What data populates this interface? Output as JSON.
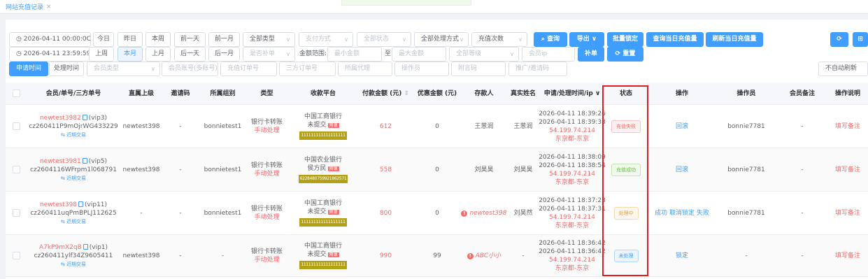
{
  "tab": {
    "title": "网站充值记录",
    "close": "×"
  },
  "filters": {
    "start_time": "2026-04-11 00:00:0C",
    "end_time": "2026-04-11 23:59:59",
    "today": "今日",
    "yesterday": "昨日",
    "this_week": "本周",
    "prev_day": "前一天",
    "prev_month": "前一月",
    "last_week": "上周",
    "this_month": "本月",
    "last_month": "上月",
    "next_day": "后一天",
    "next_month": "后一月",
    "all_types": "全部类型",
    "pay_method": "支付方式",
    "all_status": "全部状态",
    "all_process": "全部处理方式",
    "recharge_count": "充值次数",
    "is_supplement": "是否补单",
    "amount_range": "金额范围:",
    "min_amount": "最小金额",
    "to": "至",
    "max_amount": "最大金额",
    "all_levels": "全部等级",
    "member_ip": "会员ip",
    "apply_time": "申请时间",
    "process_time": "处理时间",
    "member_type": "会员类型",
    "member_account": "会员账号(多账号)",
    "recharge_order": "充值订单号",
    "third_order": "三方订单号",
    "agent": "所属代理",
    "operator": "操作员",
    "postscript": "附言码",
    "promo_code": "推广/邀请码",
    "auto_refresh": "不自动刷新"
  },
  "actions": {
    "query": "查询",
    "export": "导出",
    "batch_lock": "批量锁定",
    "today_query": "查询当日充值量",
    "today_refresh": "刷新当日充值量",
    "supplement": "补单",
    "reset": "重置",
    "refresh_icon": "refresh-icon",
    "grid_icon": "grid-icon"
  },
  "columns": [
    "会员/单号/三方单号",
    "直属上级",
    "邀请码",
    "所属组别",
    "类型",
    "收款平台",
    "付款金额 (元)",
    "优惠金额 (元)",
    "存款人",
    "真实姓名",
    "申请/处理时间/ip",
    "状态",
    "操作",
    "操作员",
    "会员备注",
    "操作说明"
  ],
  "rows": [
    {
      "member": "newtest3982",
      "vip": "(vip3)",
      "order": "cz260411P9mOjrWG433229",
      "recent": "近期交易",
      "parent": "newtest398",
      "invite": "-",
      "group": "bonnietest1",
      "type": "银行卡转账",
      "process": "手动处理",
      "bank": "中国工商银行",
      "bank_status": "未提交",
      "bank_tag": "网银",
      "account": "111111111111111111",
      "amount": "612",
      "discount": "0",
      "depositor": "王葱润",
      "real_name": "王葱润",
      "apply_time": "2026-04-11 18:39:26",
      "process_time": "2026-04-11 18:39:33",
      "ip": "54.199.74.214",
      "location": "东京都-东京",
      "status": "充值失败",
      "status_class": "st-fail",
      "operation": "回滚",
      "operator": "bonnie7781",
      "remark": "-",
      "note": "填写备注"
    },
    {
      "member": "newtest3981",
      "vip": "(vip5)",
      "order": "cz2604116WFrpm1l068791",
      "recent": "近期交易",
      "parent": "newtest398",
      "invite": "-",
      "group": "bonnietest1",
      "type": "银行卡转账",
      "process": "手动处理",
      "bank": "中国农业银行",
      "bank_status": "侯方民",
      "bank_tag": "网银",
      "account": "6228480759921862571",
      "amount": "558",
      "discount": "0",
      "depositor": "刘昊昊",
      "real_name": "刘昊昊",
      "apply_time": "2026-04-11 18:38:09",
      "process_time": "2026-04-11 18:38:54",
      "ip": "54.199.74.214",
      "location": "东京都-东京",
      "status": "充值成功",
      "status_class": "st-ok",
      "operation": "回滚",
      "operator": "bonnie7781",
      "remark": "-",
      "note": "填写备注"
    },
    {
      "member": "newtest398",
      "vip": "(vip11)",
      "order": "cz260411uqPmBPLJ112625",
      "recent": "近期交易",
      "parent": "-",
      "invite": "-",
      "group": "bonnietest1",
      "type": "银行卡转账",
      "process": "手动处理",
      "bank": "中国工商银行",
      "bank_status": "未提交",
      "bank_tag": "网银",
      "account": "111111111111111111",
      "amount": "800",
      "discount": "0",
      "depositor": "newtest398",
      "real_name": "刘昊然",
      "apply_time": "2026-04-11 18:37:23",
      "process_time": "2026-04-11 18:37:31",
      "ip": "54.199.74.214",
      "location": "东京都-东京",
      "status": "处理中",
      "status_class": "st-proc",
      "operation": "成功 取消锁定 失败",
      "operator": "bonnie7781",
      "remark": "-",
      "note": "填写备注"
    },
    {
      "member": "A7kP9mX2qB",
      "vip": "(vip1)",
      "order": "cz260411ylf34Z9605411",
      "recent": "近期交易",
      "parent": "newtest398",
      "invite": "-",
      "group": "-",
      "type": "银行卡转账",
      "process": "手动处理",
      "bank": "中国工商银行",
      "bank_status": "未提交",
      "bank_tag": "网银",
      "account": "111111111111111111",
      "amount": "990",
      "discount": "99",
      "depositor": "ABC小小",
      "real_name": "-",
      "apply_time": "2026-04-11 18:36:42",
      "process_time": "2026-04-11 18:36:42",
      "ip": "54.199.74.214",
      "location": "东京都-东京",
      "status": "未处理",
      "status_class": "st-none",
      "operation": "锁定",
      "operator": "-",
      "remark": "-",
      "note": "填写备注"
    }
  ]
}
